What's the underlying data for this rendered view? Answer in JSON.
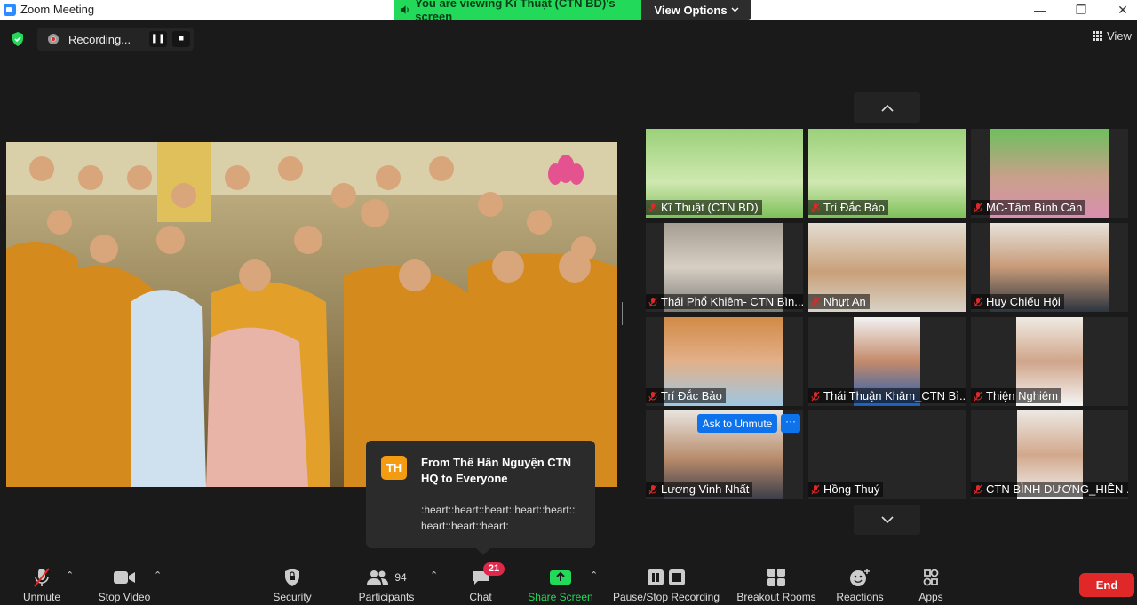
{
  "window": {
    "title": "Zoom Meeting",
    "minimize_glyph": "—",
    "maximize_glyph": "❐",
    "close_glyph": "✕"
  },
  "banner": {
    "text": "You are viewing Kĩ Thuật (CTN BD)'s screen",
    "view_options": "View Options"
  },
  "recording": {
    "label": "Recording..."
  },
  "view_button": {
    "label": "View"
  },
  "gallery": {
    "up_arrow": "⌃",
    "down_arrow": "⌄",
    "tiles": [
      {
        "name": "Kĩ Thuật (CTN BD)",
        "muted": true
      },
      {
        "name": "Trí Đắc Bảo",
        "muted": true
      },
      {
        "name": "MC-Tâm Bình Căn",
        "muted": true
      },
      {
        "name": "Thái Phổ Khiêm- CTN Bìn...",
        "muted": true
      },
      {
        "name": "Nhựt An",
        "muted": true
      },
      {
        "name": "Huy Chiếu Hội",
        "muted": true
      },
      {
        "name": "Trí Đắc Bảo",
        "muted": true
      },
      {
        "name": "Thái Thuận Khâm_CTN Bì...",
        "muted": true
      },
      {
        "name": "Thiện Nghiêm",
        "muted": true
      },
      {
        "name": "Lương Vinh Nhất",
        "muted": true
      },
      {
        "name": "Hồng Thuý",
        "muted": true
      },
      {
        "name": "CTN BÌNH DƯƠNG_HIỀN ...",
        "muted": true
      }
    ],
    "ask_to_unmute": "Ask to Unmute",
    "more": "···"
  },
  "chat_popup": {
    "initials": "TH",
    "from": "From Thế Hân Nguyện CTN HQ to Everyone",
    "message": ":heart::heart::heart::heart::heart::heart::heart::heart:"
  },
  "toolbar": {
    "unmute": "Unmute",
    "stop_video": "Stop Video",
    "security": "Security",
    "participants": "Participants",
    "participants_count": "94",
    "chat": "Chat",
    "chat_badge": "21",
    "share_screen": "Share Screen",
    "pause_stop_recording": "Pause/Stop Recording",
    "breakout_rooms": "Breakout Rooms",
    "reactions": "Reactions",
    "apps": "Apps",
    "end": "End"
  },
  "colors": {
    "accent_green": "#23d959",
    "accent_blue": "#0e72ed",
    "end_red": "#e02828",
    "badge_red": "#e0284a",
    "share_green": "#23d959"
  }
}
